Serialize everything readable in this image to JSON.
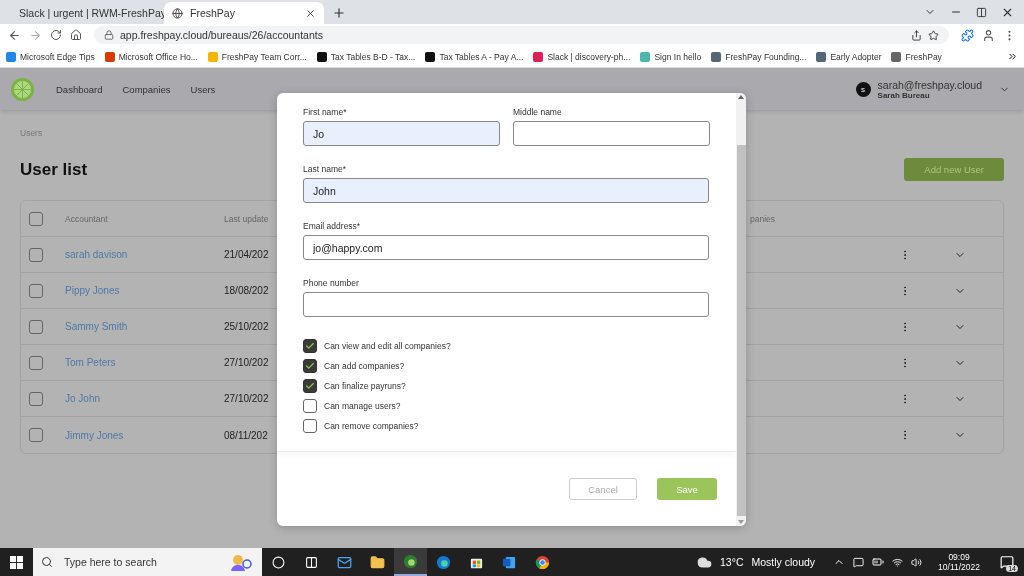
{
  "browser": {
    "tabs": [
      {
        "title": "Slack | urgent | RWM-FreshPay",
        "selected": false
      },
      {
        "title": "FreshPay",
        "selected": true
      }
    ],
    "url": "app.freshpay.cloud/bureaus/26/accountants",
    "bookmarks": [
      {
        "label": "Microsoft Edge Tips",
        "color": "#1e88e5"
      },
      {
        "label": "Microsoft Office Ho...",
        "color": "#d83b01"
      },
      {
        "label": "FreshPay Team Corr...",
        "color": "#f4b400"
      },
      {
        "label": "Tax Tables B-D - Tax...",
        "color": "#111111"
      },
      {
        "label": "Tax Tables A - Pay A...",
        "color": "#111111"
      },
      {
        "label": "Slack | discovery-ph...",
        "color": "#e01e5a"
      },
      {
        "label": "Sign In hello",
        "color": "#4db6ac"
      },
      {
        "label": "FreshPay Founding...",
        "color": "#556677"
      },
      {
        "label": "Early Adopter",
        "color": "#556677"
      },
      {
        "label": "FreshPay",
        "color": "#666666"
      }
    ]
  },
  "header": {
    "nav": [
      "Dashboard",
      "Companies",
      "Users"
    ],
    "user": {
      "initial": "s",
      "email": "sarah@freshpay.cloud",
      "name": "Sarah Bureau"
    }
  },
  "breadcrumb": "Users",
  "title": "User list",
  "add_button": "Add new User",
  "table": {
    "header_checked": false,
    "columns": [
      "Accountant",
      "Last update",
      "panies"
    ],
    "rows": [
      {
        "name": "sarah davison",
        "last_update": "21/04/202",
        "checked": false
      },
      {
        "name": "Pippy Jones",
        "last_update": "18/08/202",
        "checked": false
      },
      {
        "name": "Sammy Smith",
        "last_update": "25/10/202",
        "checked": false
      },
      {
        "name": "Tom Peters",
        "last_update": "27/10/202",
        "checked": false
      },
      {
        "name": "Jo John",
        "last_update": "27/10/202",
        "checked": false
      },
      {
        "name": "Jimmy Jones",
        "last_update": "08/11/202",
        "checked": false
      }
    ]
  },
  "modal": {
    "fields": [
      {
        "label": "First name*",
        "value": "Jo",
        "autofilled": true,
        "half": true
      },
      {
        "label": "Middle name",
        "autofilled": false,
        "half": true
      },
      {
        "label": "Last name*",
        "value": "John",
        "autofilled": true
      },
      {
        "label": "Email address*",
        "value": "jo@happy.com",
        "autofilled": false
      },
      {
        "label": "Phone number",
        "autofilled": false
      }
    ],
    "permissions": [
      {
        "label": "Can view and edit all companies?",
        "checked": true
      },
      {
        "label": "Can add companies?",
        "checked": true
      },
      {
        "label": "Can finalize payruns?",
        "checked": true
      },
      {
        "label": "Can manage users?",
        "checked": false
      },
      {
        "label": "Can remove companies?",
        "checked": false
      }
    ],
    "cancel": "Cancel",
    "save": "Save"
  },
  "taskbar": {
    "search_placeholder": "Type here to search",
    "apps": [
      {
        "kind": "mail",
        "selected": false
      },
      {
        "kind": "folder",
        "selected": false
      },
      {
        "kind": "edgedev",
        "selected": true
      },
      {
        "kind": "edge",
        "selected": false
      },
      {
        "kind": "store",
        "selected": false
      },
      {
        "kind": "word",
        "selected": false
      },
      {
        "kind": "chrome",
        "selected": false
      }
    ],
    "temperature": "13°C",
    "weather": "Mostly cloudy",
    "time": "09:09",
    "date": "10/11/2022",
    "notifications": "14"
  }
}
